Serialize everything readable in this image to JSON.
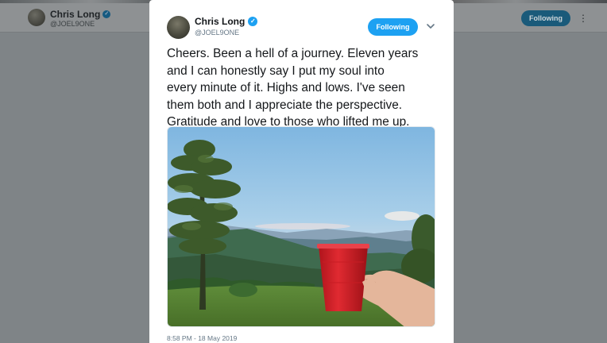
{
  "background": {
    "name": "Chris Long",
    "handle": "@JOEL9ONE",
    "follow_label": "Following",
    "more_icon": "more-vertical-icon"
  },
  "tweet": {
    "name": "Chris Long",
    "handle": "@JOEL9ONE",
    "verified_icon": "verified-badge-icon",
    "follow_label": "Following",
    "menu_icon": "chevron-down-icon",
    "text": "Cheers. Been a hell of a journey. Eleven years\nand I can honestly say I put my soul into\nevery minute of it. Highs and lows. I've seen\nthem both and I appreciate the perspective.\nGratitude and love to those who lifted me up.",
    "timestamp": "8:58 PM - 18 May 2019"
  },
  "colors": {
    "accent": "#1da1f2",
    "overlay": "#7f8487",
    "cup": "#d8232a"
  }
}
